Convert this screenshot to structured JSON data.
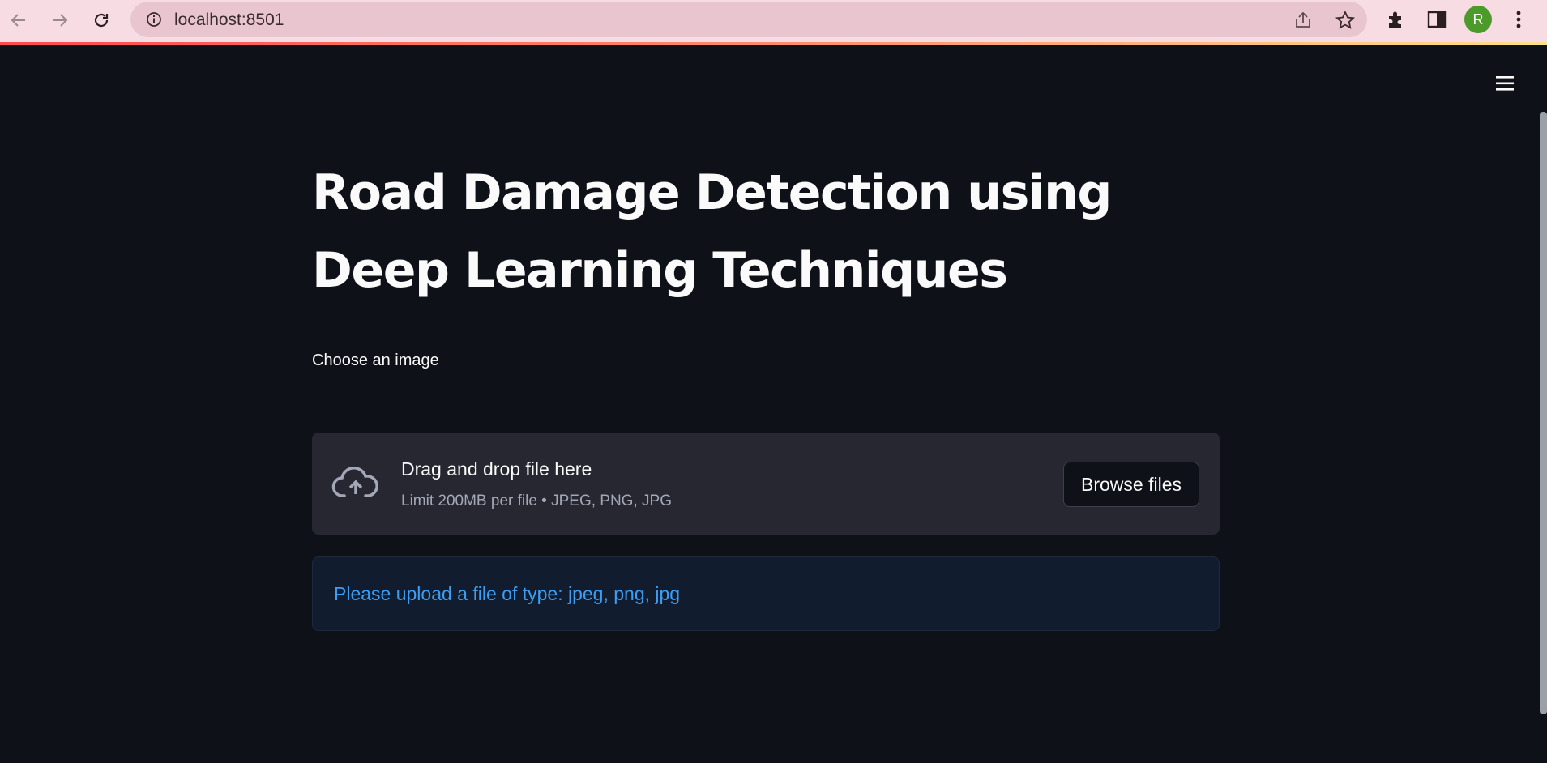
{
  "browser": {
    "url": "localhost:8501",
    "avatar_letter": "R",
    "avatar_color": "#4c9a2a",
    "icons": [
      "back-icon",
      "forward-icon",
      "reload-icon",
      "info-icon",
      "share-icon",
      "star-icon",
      "extensions-icon",
      "side-panel-icon",
      "kebab-menu-icon"
    ]
  },
  "app": {
    "title": "Road Damage Detection using Deep Learning Techniques",
    "uploader": {
      "label": "Choose an image",
      "drag_text": "Drag and drop file here",
      "limit_text": "Limit 200MB per file • JPEG, PNG, JPG",
      "browse_label": "Browse files"
    },
    "info_message": "Please upload a file of type: jpeg, png, jpg"
  },
  "colors": {
    "background": "#0e1117",
    "dropzone": "#262730",
    "info_text": "#3d9df3",
    "info_bg": "#111c2e"
  }
}
